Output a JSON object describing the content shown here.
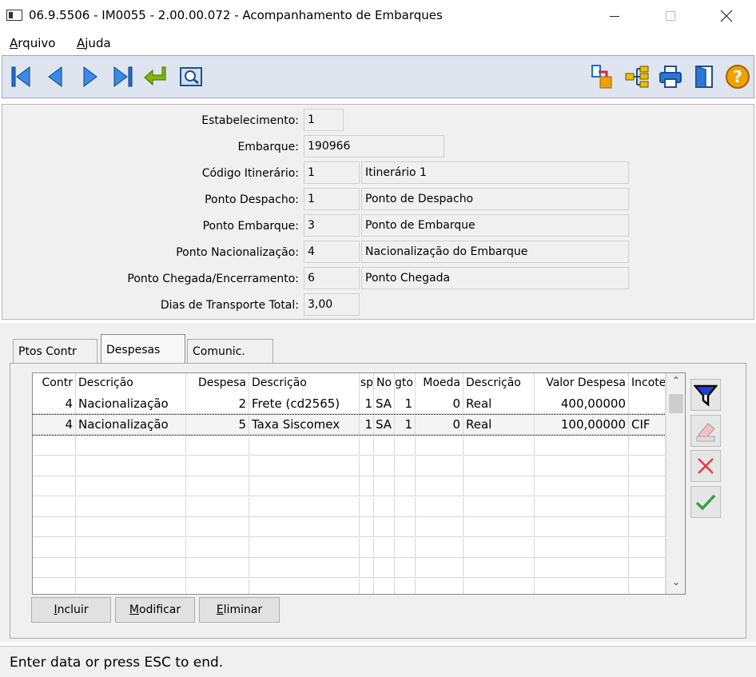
{
  "window": {
    "title": "06.9.5506 - IM0055 - 2.00.00.072 - Acompanhamento de Embarques"
  },
  "menu": {
    "arquivo": {
      "mnemonic": "A",
      "rest": "rquivo"
    },
    "ajuda": {
      "mnemonic": "A",
      "rest": "juda"
    }
  },
  "toolbar": {
    "nav_icons": [
      "first-record-icon",
      "previous-record-icon",
      "next-record-icon",
      "last-record-icon",
      "return-icon",
      "zoom-search-icon"
    ],
    "right_icons": [
      "document-export-icon",
      "tree-structure-icon",
      "print-icon",
      "exit-door-icon",
      "help-icon"
    ]
  },
  "form": {
    "estabelecimento": {
      "label": "Estabelecimento:",
      "value": "1"
    },
    "embarque": {
      "label": "Embarque:",
      "value": "190966"
    },
    "codigo_itinerario": {
      "label": "Código Itinerário:",
      "value": "1",
      "desc": "Itinerário 1"
    },
    "ponto_despacho": {
      "label": "Ponto Despacho:",
      "value": "1",
      "desc": "Ponto de Despacho"
    },
    "ponto_embarque": {
      "label": "Ponto Embarque:",
      "value": "3",
      "desc": "Ponto de Embarque"
    },
    "ponto_nacionalizacao": {
      "label": "Ponto Nacionalização:",
      "value": "4",
      "desc": "Nacionalização do Embarque"
    },
    "ponto_chegada": {
      "label": "Ponto Chegada/Encerramento:",
      "value": "6",
      "desc": "Ponto Chegada"
    },
    "dias_transporte": {
      "label": "Dias de Transporte Total:",
      "value": "3,00"
    }
  },
  "tabs": [
    {
      "label": "Ptos Contr",
      "active": false
    },
    {
      "label": "Despesas",
      "active": true
    },
    {
      "label": "Comunic.",
      "active": false
    }
  ],
  "grid": {
    "headers": [
      "Contr",
      "Descrição",
      "Despesa",
      "Descrição",
      "sp",
      "No",
      "gto",
      "Moeda",
      "Descrição",
      "Valor Despesa",
      "Incote"
    ],
    "rows": [
      [
        "4",
        "Nacionalização",
        "2",
        "Frete (cd2565)",
        "1",
        "SA",
        "1",
        "0",
        "Real",
        "400,00000",
        ""
      ],
      [
        "4",
        "Nacionalização",
        "5",
        "Taxa Siscomex",
        "1",
        "SA",
        "1",
        "0",
        "Real",
        "100,00000",
        "CIF"
      ]
    ],
    "selected_row": 1,
    "empty_rows": 8
  },
  "side_buttons": [
    "filter-funnel-icon",
    "eraser-icon",
    "delete-x-icon",
    "confirm-check-icon"
  ],
  "buttons": {
    "incluir": {
      "mnemonic": "I",
      "rest": "ncluir"
    },
    "modificar": {
      "mnemonic": "M",
      "rest": "odificar"
    },
    "eliminar": {
      "mnemonic": "E",
      "rest": "liminar"
    }
  },
  "status": {
    "text": "Enter data or press ESC to end."
  },
  "colors": {
    "toolbar_bg": "#dfe5ee",
    "panel_bg": "#f0f0f0",
    "nav_blue": "#1f6fd1",
    "return_green": "#7cb800",
    "help_orange": "#f0a000"
  }
}
